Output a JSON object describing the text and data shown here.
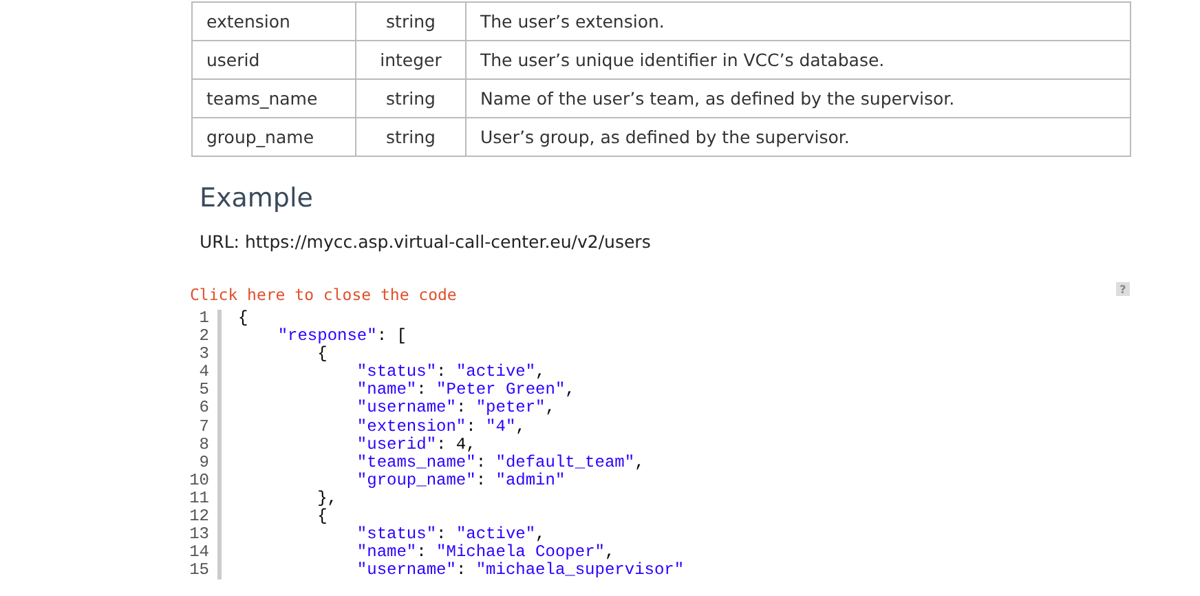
{
  "table": {
    "rows": [
      {
        "field": "extension",
        "type": "string",
        "description": "The user’s extension."
      },
      {
        "field": "userid",
        "type": "integer",
        "description": "The user’s unique identifier in VCC’s database."
      },
      {
        "field": "teams_name",
        "type": "string",
        "description": "Name of the user’s team, as defined by the supervisor."
      },
      {
        "field": "group_name",
        "type": "string",
        "description": "User’s group, as defined by the supervisor."
      }
    ]
  },
  "example": {
    "heading": "Example",
    "url_line": "URL: https://mycc.asp.virtual-call-center.eu/v2/users"
  },
  "code_block": {
    "toggle_link": "Click here to close the code",
    "help_button": "?",
    "lines": [
      {
        "number": "1",
        "text": "{"
      },
      {
        "number": "2",
        "text": "    \"response\": ["
      },
      {
        "number": "3",
        "text": "        {"
      },
      {
        "number": "4",
        "text": "            \"status\": \"active\","
      },
      {
        "number": "5",
        "text": "            \"name\": \"Peter Green\","
      },
      {
        "number": "6",
        "text": "            \"username\": \"peter\","
      },
      {
        "number": "7",
        "text": "            \"extension\": \"4\","
      },
      {
        "number": "8",
        "text": "            \"userid\": 4,"
      },
      {
        "number": "9",
        "text": "            \"teams_name\": \"default_team\","
      },
      {
        "number": "10",
        "text": "            \"group_name\": \"admin\""
      },
      {
        "number": "11",
        "text": "        },"
      },
      {
        "number": "12",
        "text": "        {"
      },
      {
        "number": "13",
        "text": "            \"status\": \"active\","
      },
      {
        "number": "14",
        "text": "            \"name\": \"Michaela Cooper\","
      },
      {
        "number": "15",
        "text": "            \"username\": \"michaela_supervisor\""
      }
    ]
  }
}
